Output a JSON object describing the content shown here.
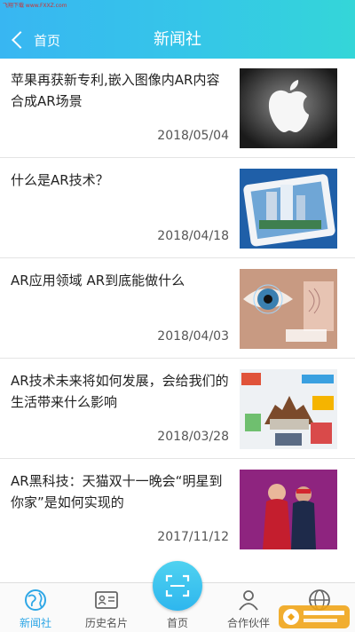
{
  "watermark": "飞翔下载 www.FXXZ.com",
  "header": {
    "back_label": "首页",
    "title": "新闻社"
  },
  "articles": [
    {
      "title": "苹果再获新专利,嵌入图像内AR内容合成AR场景",
      "date": "2018/05/04"
    },
    {
      "title": "什么是AR技术？",
      "date": "2018/04/18"
    },
    {
      "title": "AR应用领域 AR到底能做什么",
      "date": "2018/04/03"
    },
    {
      "title": "AR技术未来将如何发展，会给我们的生活带来什么影响",
      "date": "2018/03/28"
    },
    {
      "title": "AR黑科技：天猫双十一晚会“明星到你家”是如何实现的",
      "date": "2017/11/12"
    }
  ],
  "tabbar": {
    "active_index": 0,
    "items": [
      {
        "label": "新闻社",
        "icon": "globe-icon"
      },
      {
        "label": "历史名片",
        "icon": "id-card-icon"
      },
      {
        "label": "首页",
        "icon": "scan-icon"
      },
      {
        "label": "合作伙伴",
        "icon": "person-icon"
      },
      {
        "label": "",
        "icon": "location-globe-icon"
      }
    ]
  },
  "colors": {
    "accent": "#2fa7e6",
    "header_start": "#38b6f2",
    "header_end": "#34d6d8"
  }
}
